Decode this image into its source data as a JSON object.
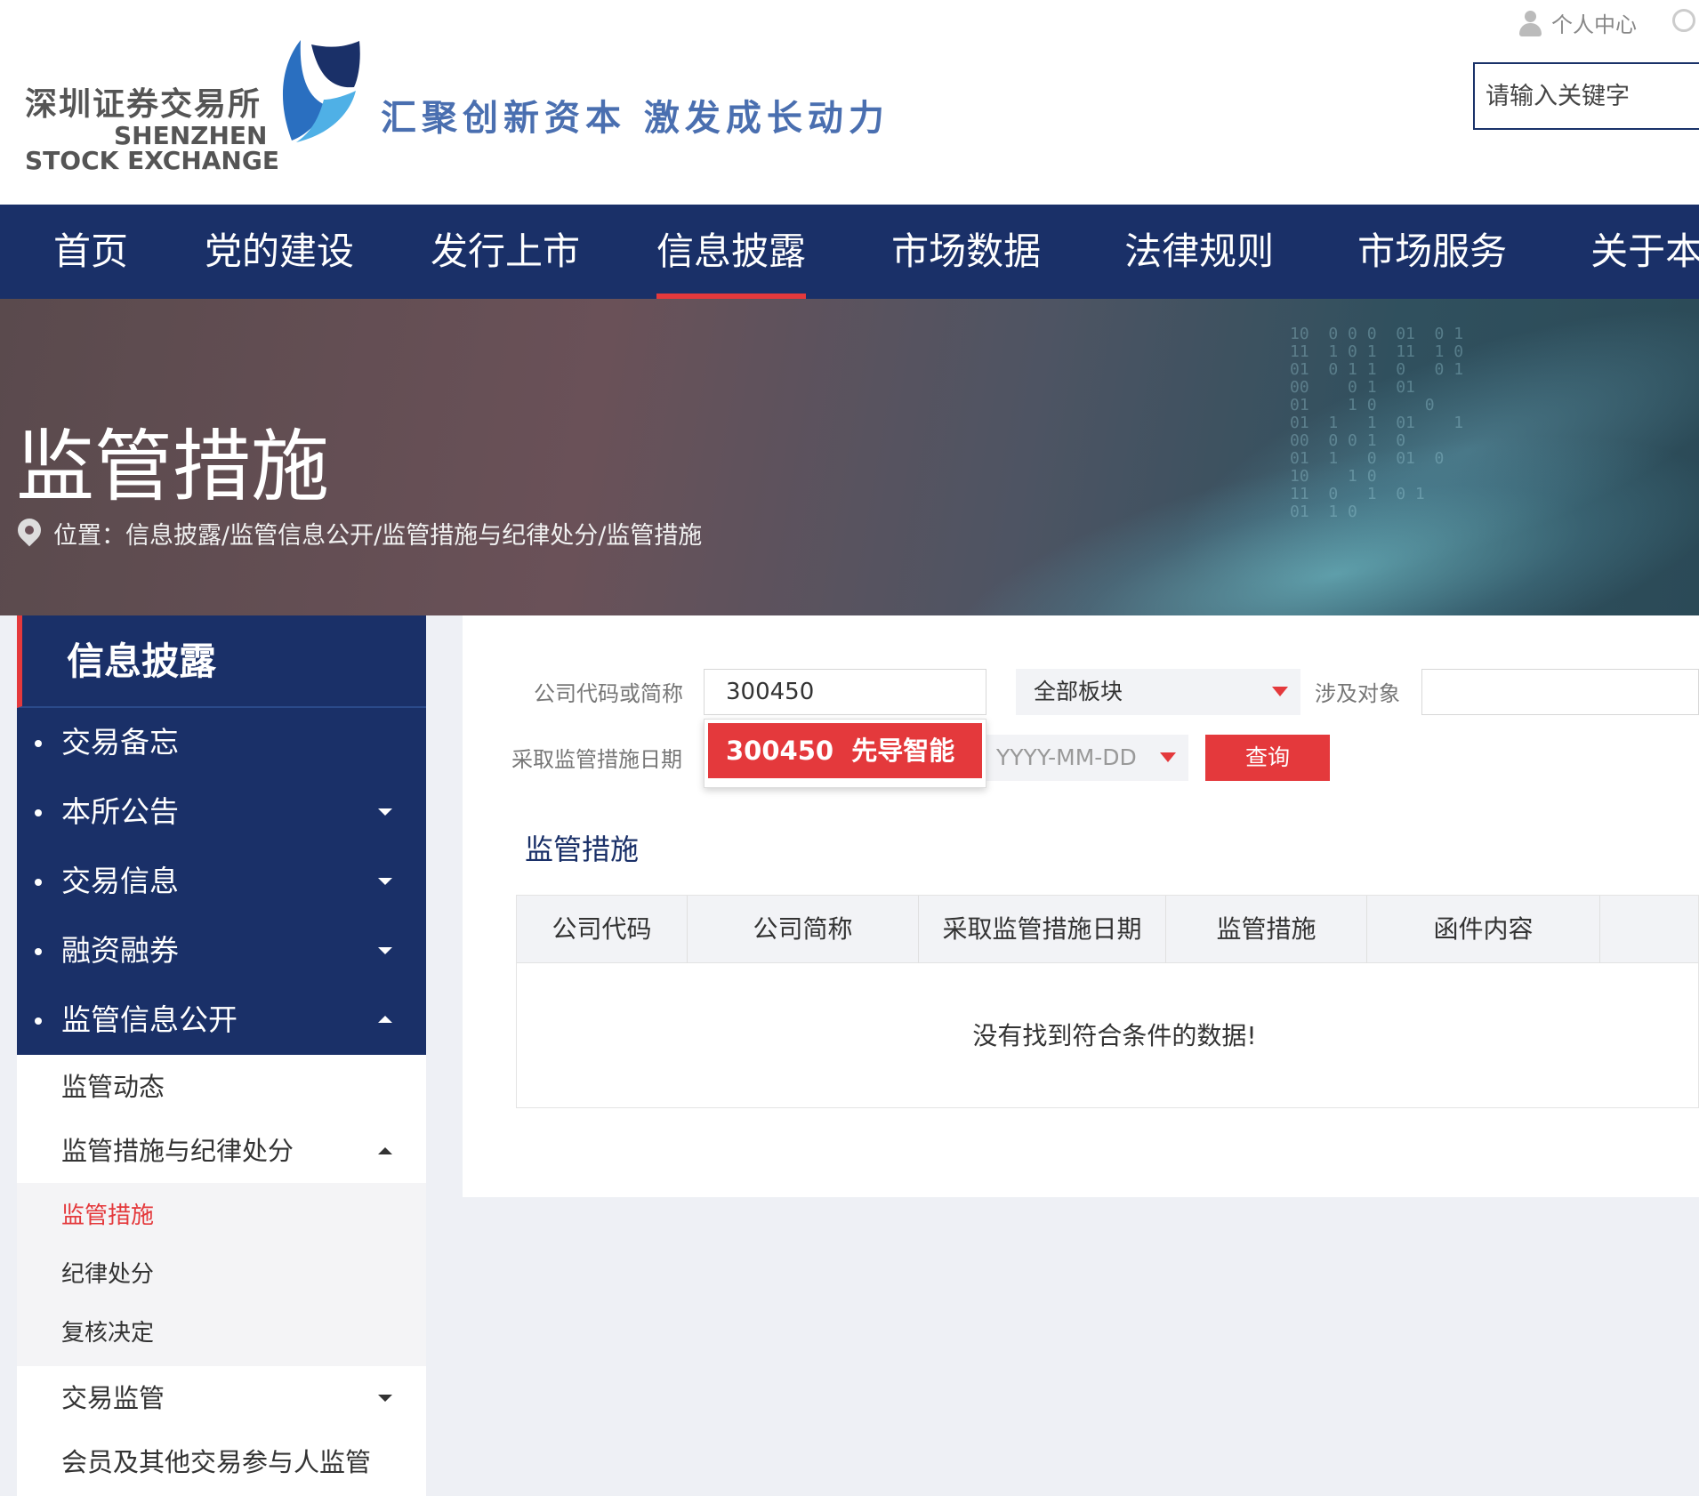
{
  "header": {
    "logo_cn": "深圳证券交易所",
    "logo_en_line1": "SHENZHEN",
    "logo_en_line2": "STOCK EXCHANGE",
    "slogan": "汇聚创新资本  激发成长动力",
    "personal_center": "个人中心",
    "search_placeholder": "请输入关键字"
  },
  "nav": {
    "items": [
      {
        "label": "首页",
        "active": false
      },
      {
        "label": "党的建设",
        "active": false
      },
      {
        "label": "发行上市",
        "active": false
      },
      {
        "label": "信息披露",
        "active": true
      },
      {
        "label": "市场数据",
        "active": false
      },
      {
        "label": "法律规则",
        "active": false
      },
      {
        "label": "市场服务",
        "active": false
      },
      {
        "label": "关于本所",
        "active": false
      }
    ]
  },
  "banner": {
    "title": "监管措施",
    "breadcrumb": "位置：信息披露/监管信息公开/监管措施与纪律处分/监管措施"
  },
  "sidebar": {
    "header": "信息披露",
    "items": [
      {
        "label": "交易备忘"
      },
      {
        "label": "本所公告"
      },
      {
        "label": "交易信息"
      },
      {
        "label": "融资融券"
      },
      {
        "label": "监管信息公开"
      }
    ],
    "sub_items": [
      {
        "label": "监管动态"
      },
      {
        "label": "监管措施与纪律处分"
      }
    ],
    "subsub_items": [
      {
        "label": "监管措施",
        "active": true
      },
      {
        "label": "纪律处分",
        "active": false
      },
      {
        "label": "复核决定",
        "active": false
      }
    ],
    "more_items": [
      {
        "label": "交易监管"
      },
      {
        "label": "会员及其他交易参与人监管"
      }
    ]
  },
  "filters": {
    "company_label": "公司代码或简称",
    "company_value": "300450",
    "board_select": "全部板块",
    "subject_label": "涉及对象",
    "subject_value": "",
    "date_label": "采取监管措施日期",
    "date_placeholder": "YYYY-MM-DD",
    "query_label": "查询"
  },
  "suggestion": {
    "code": "300450",
    "name": "先导智能"
  },
  "results": {
    "title": "监管措施",
    "columns": [
      "公司代码",
      "公司简称",
      "采取监管措施日期",
      "监管措施",
      "函件内容"
    ],
    "empty_message": "没有找到符合条件的数据!"
  },
  "colors": {
    "brand_navy": "#1a3068",
    "accent_red": "#e4393c",
    "slogan_blue": "#4a6fb0"
  }
}
